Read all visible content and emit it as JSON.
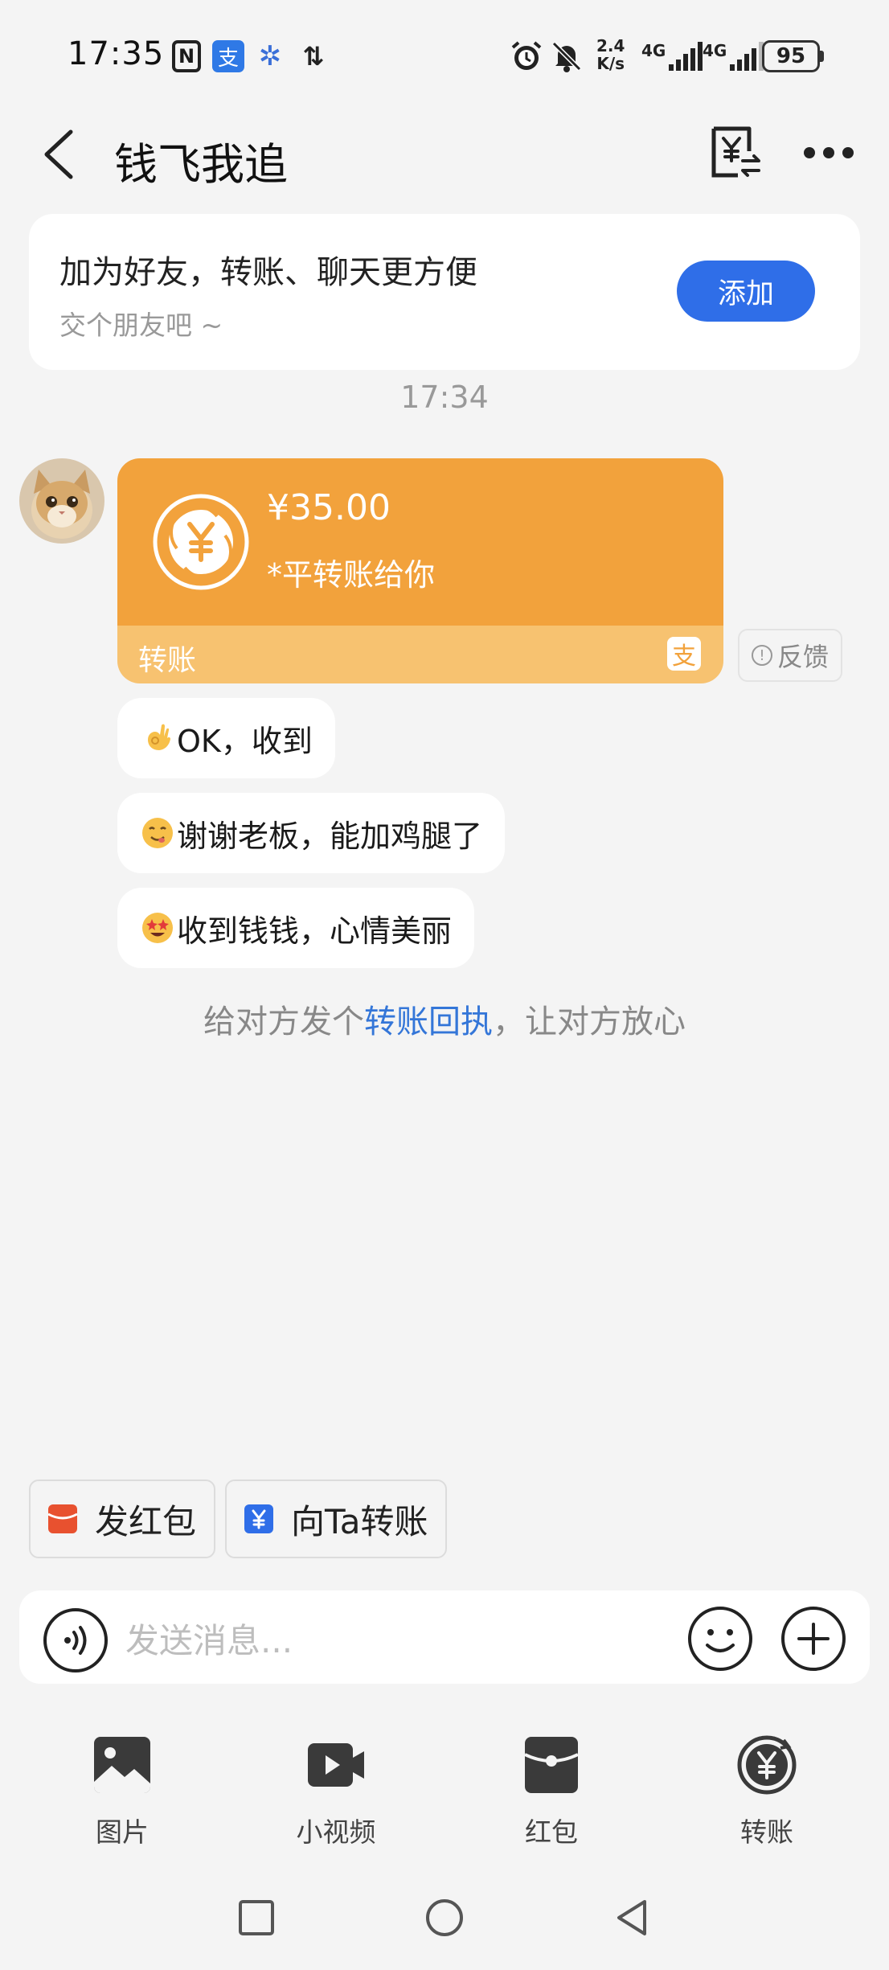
{
  "status_bar": {
    "time": "17:35",
    "net_speed_top": "2.4",
    "net_speed_bottom": "K/s",
    "sim1": "4G",
    "sim2": "4G",
    "battery": "95"
  },
  "header": {
    "title": "钱飞我追"
  },
  "friend_card": {
    "title": "加为好友，转账、聊天更方便",
    "subtitle": "交个朋友吧 ~",
    "button_label": "添加"
  },
  "chat": {
    "timestamp": "17:34",
    "transfer": {
      "amount": "¥35.00",
      "note": "*平转账给你",
      "label": "转账",
      "feedback_label": "反馈"
    },
    "messages": [
      {
        "emoji": "ok-hand",
        "text": "OK，收到"
      },
      {
        "emoji": "yum-face",
        "text": "谢谢老板，能加鸡腿了"
      },
      {
        "emoji": "star-eyes-face",
        "text": "收到钱钱，心情美丽"
      }
    ],
    "receipt_tip": {
      "before": "给对方发个",
      "link": "转账回执",
      "after": "，让对方放心"
    }
  },
  "quick_actions": [
    {
      "label": "发红包",
      "icon": "red-packet-icon",
      "color": "#e8512f"
    },
    {
      "label": "向Ta转账",
      "icon": "transfer-icon",
      "color": "#2f6ee8"
    }
  ],
  "input": {
    "placeholder": "发送消息..."
  },
  "tools": [
    {
      "label": "图片",
      "icon": "image-icon"
    },
    {
      "label": "小视频",
      "icon": "video-icon"
    },
    {
      "label": "红包",
      "icon": "red-packet-icon"
    },
    {
      "label": "转账",
      "icon": "transfer-icon"
    }
  ],
  "colors": {
    "accent": "#2f6ee8",
    "transfer_orange": "#f2a23c",
    "link": "#3476d8"
  }
}
